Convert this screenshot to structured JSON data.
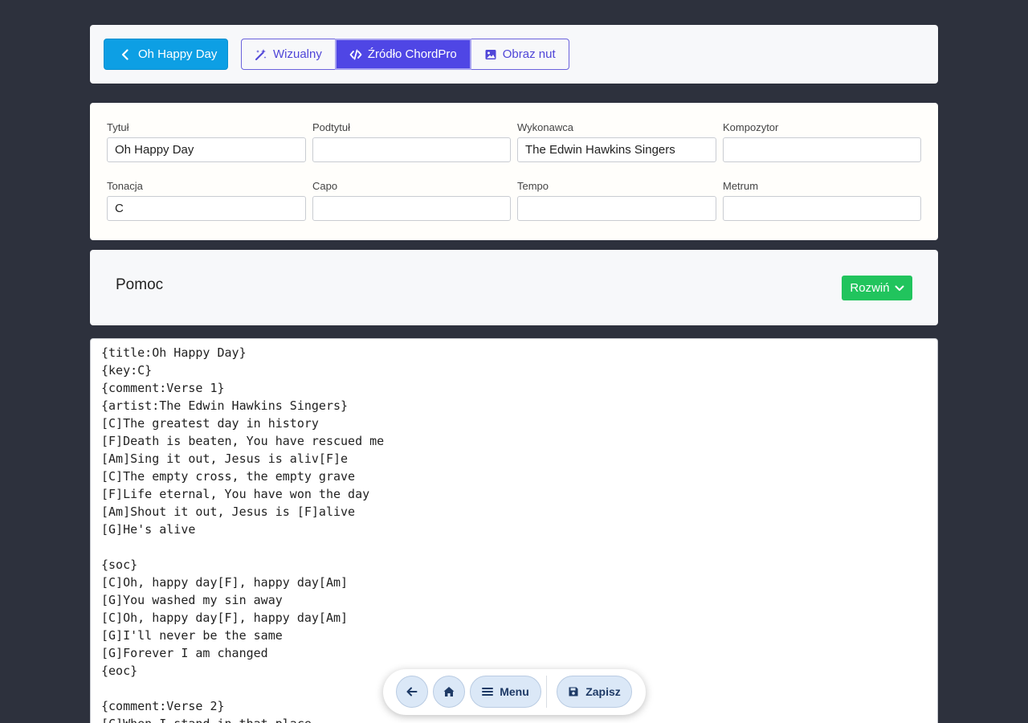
{
  "toolbar": {
    "back_label": "Oh Happy Day",
    "modes": [
      {
        "label": "Wizualny",
        "icon": "magic-wand-icon",
        "active": false
      },
      {
        "label": "Źródło ChordPro",
        "icon": "code-icon",
        "active": true
      },
      {
        "label": "Obraz nut",
        "icon": "image-icon",
        "active": false
      }
    ]
  },
  "meta": {
    "fields": [
      {
        "label": "Tytuł",
        "value": "Oh Happy Day"
      },
      {
        "label": "Podtytuł",
        "value": ""
      },
      {
        "label": "Wykonawca",
        "value": "The Edwin Hawkins Singers"
      },
      {
        "label": "Kompozytor",
        "value": ""
      },
      {
        "label": "Tonacja",
        "value": "C"
      },
      {
        "label": "Capo",
        "value": ""
      },
      {
        "label": "Tempo",
        "value": ""
      },
      {
        "label": "Metrum",
        "value": ""
      }
    ]
  },
  "help": {
    "title": "Pomoc",
    "expand_label": "Rozwiń"
  },
  "editor": {
    "lines": [
      "{title:Oh Happy Day}",
      "{key:C}",
      "{comment:Verse 1}",
      "{artist:The Edwin Hawkins Singers}",
      "[C]The greatest day in history",
      "[F]Death is beaten, You have rescued me",
      "[Am]Sing it out, Jesus is aliv[F]e",
      "[C]The empty cross, the empty grave",
      "[F]Life eternal, You have won the day",
      "[Am]Shout it out, Jesus is [F]alive",
      "[G]He's alive",
      "",
      "{soc}",
      "[C]Oh, happy day[F], happy day[Am]",
      "[G]You washed my sin away",
      "[C]Oh, happy day[F], happy day[Am]",
      "[G]I'll never be the same",
      "[G]Forever I am changed",
      "{eoc}",
      "",
      "{comment:Verse 2}",
      "[C]When I stand in that place"
    ]
  },
  "floatbar": {
    "menu_label": "Menu",
    "save_label": "Zapisz"
  },
  "colors": {
    "background": "#2d313d",
    "primary_blue": "#0d9fe4",
    "indigo": "#4f46e5",
    "green": "#21c45d"
  }
}
